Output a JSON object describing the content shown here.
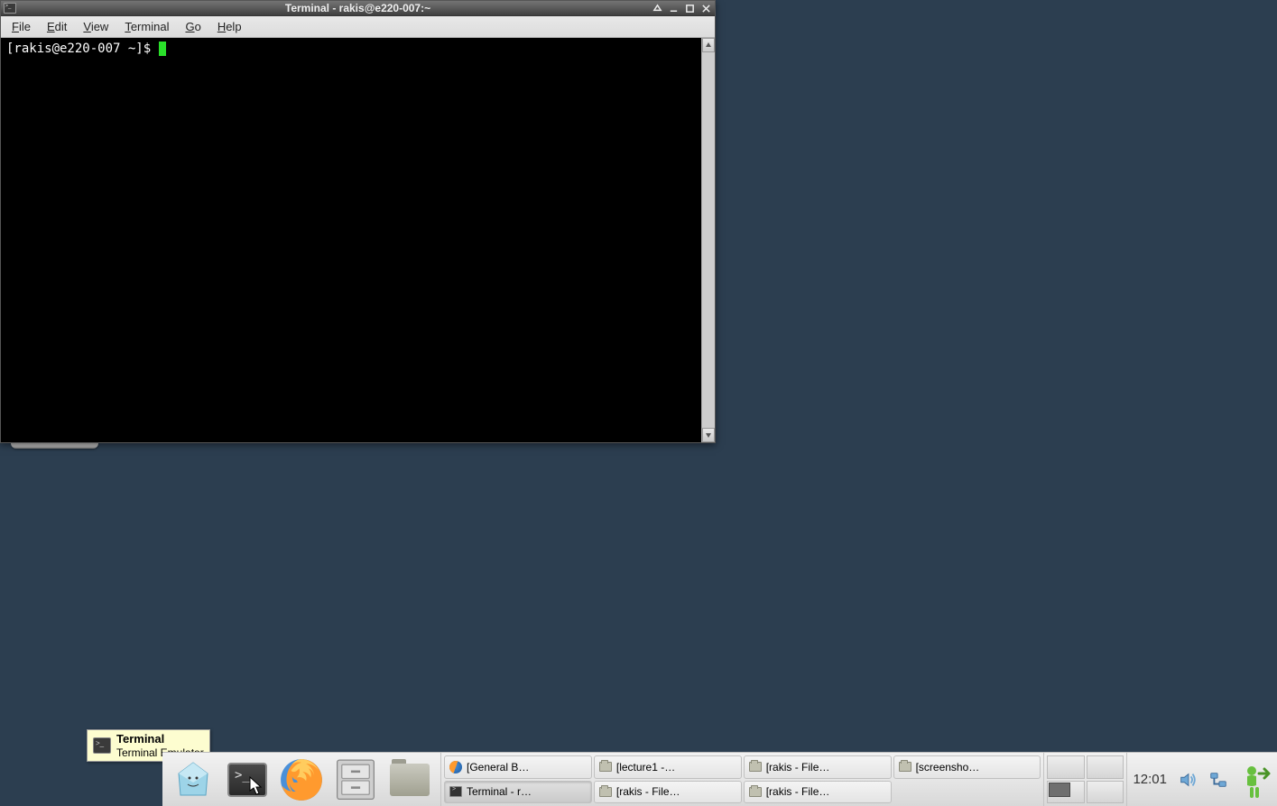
{
  "window": {
    "title": "Terminal - rakis@e220-007:~",
    "menubar": {
      "file": "File",
      "edit": "Edit",
      "view": "View",
      "terminal": "Terminal",
      "go": "Go",
      "help": "Help"
    },
    "prompt": "[rakis@e220-007 ~]$ "
  },
  "tooltip": {
    "title": "Terminal",
    "subtitle": "Terminal Emulator"
  },
  "taskbar": {
    "items": [
      {
        "label": "[General B…",
        "icon": "firefox"
      },
      {
        "label": "[lecture1 -…",
        "icon": "folder"
      },
      {
        "label": "[rakis - File…",
        "icon": "folder"
      },
      {
        "label": "[screensho…",
        "icon": "folder"
      },
      {
        "label": "Terminal - r…",
        "icon": "terminal",
        "active": true
      },
      {
        "label": "[rakis - File…",
        "icon": "folder"
      },
      {
        "label": "[rakis - File…",
        "icon": "folder"
      }
    ]
  },
  "clock": "12:01"
}
